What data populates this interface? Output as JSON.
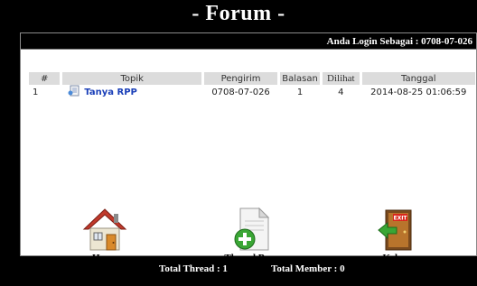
{
  "page": {
    "title": "- Forum -"
  },
  "login": {
    "label": "Anda Login Sebagai : 0708-07-026"
  },
  "table": {
    "headers": [
      "#",
      "Topik",
      "Pengirim",
      "Balasan",
      "Dilihat",
      "Tanggal"
    ],
    "rows": [
      {
        "no": "1",
        "topic": "Tanya RPP",
        "sender": "0708-07-026",
        "replies": "1",
        "views": "4",
        "date": "2014-08-25 01:06:59"
      }
    ]
  },
  "nav": {
    "home": {
      "label": "Home",
      "icon": "house-icon"
    },
    "new_thread": {
      "label": "Thread Baru",
      "icon": "new-document-icon"
    },
    "logout": {
      "label": "Keluar",
      "icon": "exit-door-icon"
    }
  },
  "footer": {
    "total_thread": "Total Thread : 1",
    "total_member": "Total Member : 0"
  },
  "colors": {
    "background": "#000000",
    "panel": "#ffffff",
    "link": "#1a3fb8",
    "header_cell": "#dcdcdc"
  }
}
